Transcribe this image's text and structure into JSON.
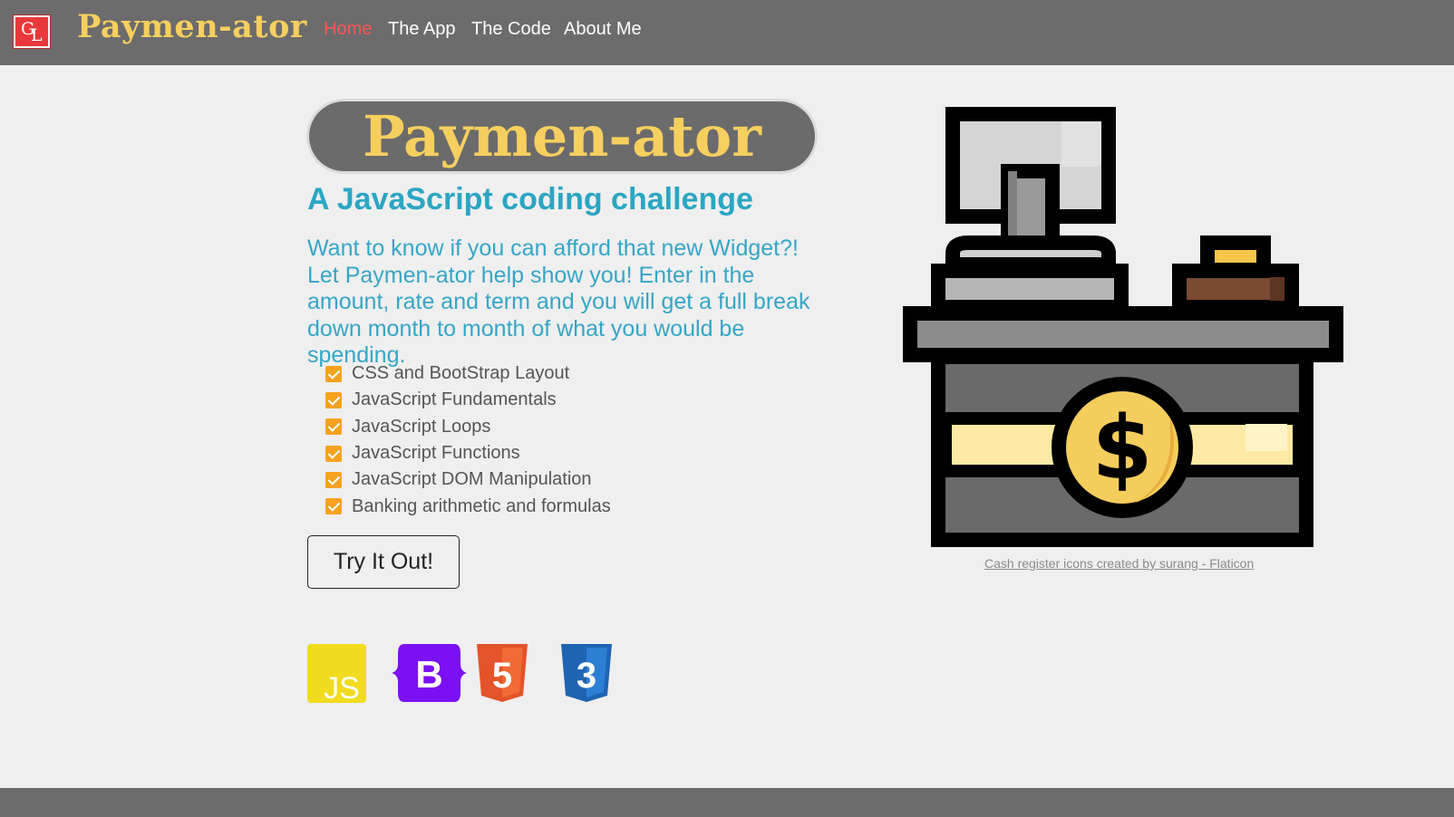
{
  "navbar": {
    "brand_logo_letters": [
      "G",
      "L"
    ],
    "brand_name": "Paymen-ator",
    "links": [
      {
        "label": "Home",
        "active": true
      },
      {
        "label": "The App",
        "active": false
      },
      {
        "label": "The Code",
        "active": false
      },
      {
        "label": "About Me",
        "active": false
      }
    ]
  },
  "hero": {
    "title": "Paymen-ator",
    "subtitle": "A JavaScript coding challenge",
    "description": "Want to know if you can afford that new Widget?! Let Paymen-ator help show you! Enter in the amount, rate and term and you will get a full break down month to month of what you would be spending.",
    "features": [
      "CSS and BootStrap Layout",
      "JavaScript Fundamentals",
      "JavaScript Loops",
      "JavaScript Functions",
      "JavaScript DOM Manipulation",
      "Banking arithmetic and formulas"
    ],
    "cta_label": "Try It Out!"
  },
  "tech_icons": [
    {
      "icon": "javascript-icon",
      "text": "JS"
    },
    {
      "icon": "bootstrap-icon",
      "text": "B"
    },
    {
      "icon": "html5-icon",
      "text": "5"
    },
    {
      "icon": "css3-icon",
      "text": "3"
    }
  ],
  "illustration": {
    "icon": "cash-register-icon",
    "symbol": "$",
    "credit": "Cash register icons created by surang - Flaticon"
  },
  "colors": {
    "navbar_bg": "#6c6c6c",
    "brand_yellow": "#f7cf5f",
    "active_link": "#ff5454",
    "accent_blue": "#2aa6c3",
    "check_orange": "#f6a21f",
    "page_bg": "#efefef"
  }
}
